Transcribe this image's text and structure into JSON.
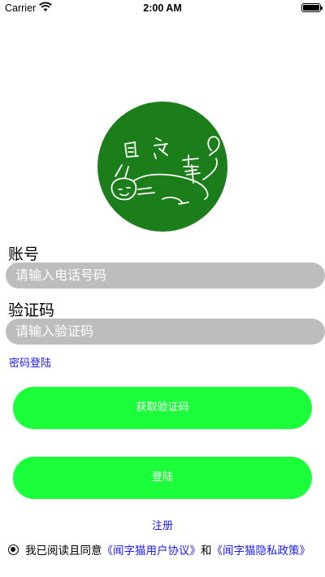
{
  "status_bar": {
    "carrier": "Carrier",
    "time": "2:00 AM"
  },
  "logo": {
    "icon": "cat-logo-icon",
    "text": "闻字猫",
    "color": "#1b7e1b"
  },
  "form": {
    "account_label": "账号",
    "account_placeholder": "请输入电话号码",
    "code_label": "验证码",
    "code_placeholder": "请输入验证码",
    "password_login_link": "密码登陆"
  },
  "buttons": {
    "get_code": "获取验证码",
    "login": "登陆"
  },
  "register_link": "注册",
  "agreement": {
    "prefix": "我已阅读且同意",
    "user_agreement": "《闻字猫用户协议》",
    "conjunction": "和",
    "privacy_policy": "《闻字猫隐私政策》"
  },
  "colors": {
    "accent_green": "#1aff3a",
    "logo_green": "#1b7e1b",
    "link_blue": "#1a1aff",
    "field_gray": "#bdbdbd"
  }
}
